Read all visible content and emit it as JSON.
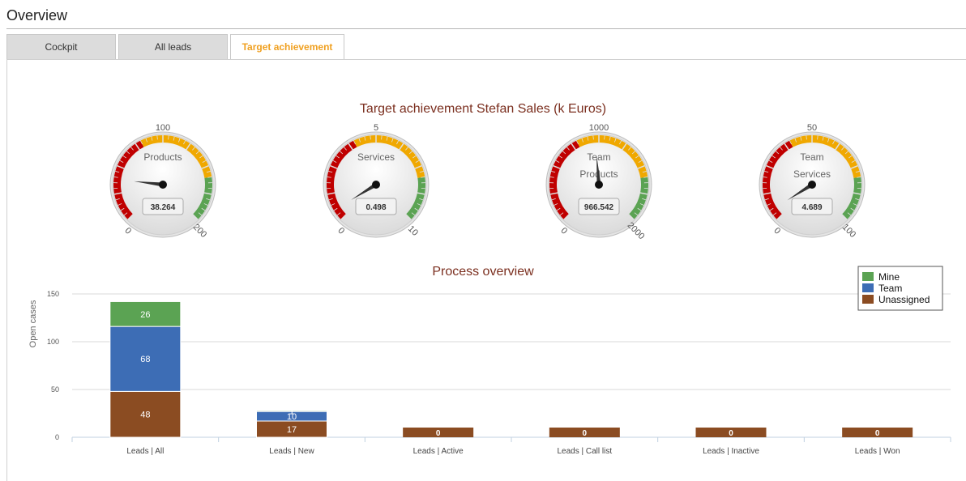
{
  "header": {
    "title": "Overview"
  },
  "tabs": [
    {
      "label": "Cockpit",
      "active": false
    },
    {
      "label": "All leads",
      "active": false
    },
    {
      "label": "Target achievement",
      "active": true
    }
  ],
  "gauges": {
    "title": "Target achievement Stefan Sales (k Euros)",
    "items": [
      {
        "label_lines": [
          "Products"
        ],
        "top_label": "100",
        "min_label": "0",
        "max_label": "200",
        "min": 0,
        "max": 200,
        "value": 38.264,
        "value_text": "38.264"
      },
      {
        "label_lines": [
          "Services"
        ],
        "top_label": "5",
        "min_label": "0",
        "max_label": "10",
        "min": 0,
        "max": 10,
        "value": 0.498,
        "value_text": "0.498"
      },
      {
        "label_lines": [
          "Team",
          "Products"
        ],
        "top_label": "1000",
        "min_label": "0",
        "max_label": "2000",
        "min": 0,
        "max": 2000,
        "value": 966.542,
        "value_text": "966.542"
      },
      {
        "label_lines": [
          "Team",
          "Services"
        ],
        "top_label": "50",
        "min_label": "0",
        "max_label": "100",
        "min": 0,
        "max": 100,
        "value": 4.689,
        "value_text": "4.689"
      }
    ],
    "colors": {
      "red": "#c00000",
      "yellow": "#f0a800",
      "green": "#5ba353"
    }
  },
  "chart_data": {
    "type": "bar",
    "stacked": true,
    "title": "Process overview",
    "xlabel": "",
    "ylabel": "Open cases",
    "ylim": [
      0,
      150
    ],
    "yticks": [
      "0",
      "50",
      "100",
      "150"
    ],
    "categories": [
      "Leads | All",
      "Leads | New",
      "Leads | Active",
      "Leads | Call list",
      "Leads | Inactive",
      "Leads | Won"
    ],
    "series": [
      {
        "name": "Unassigned",
        "color": "#8b4c22",
        "values": [
          48,
          17,
          0,
          0,
          0,
          0
        ]
      },
      {
        "name": "Team",
        "color": "#3d6db5",
        "values": [
          68,
          10,
          0,
          0,
          0,
          0
        ]
      },
      {
        "name": "Mine",
        "color": "#5ba353",
        "values": [
          26,
          1,
          0,
          0,
          0,
          0
        ]
      }
    ],
    "legend_order": [
      "Mine",
      "Team",
      "Unassigned"
    ],
    "legend_position": "top-right",
    "grid": true
  }
}
